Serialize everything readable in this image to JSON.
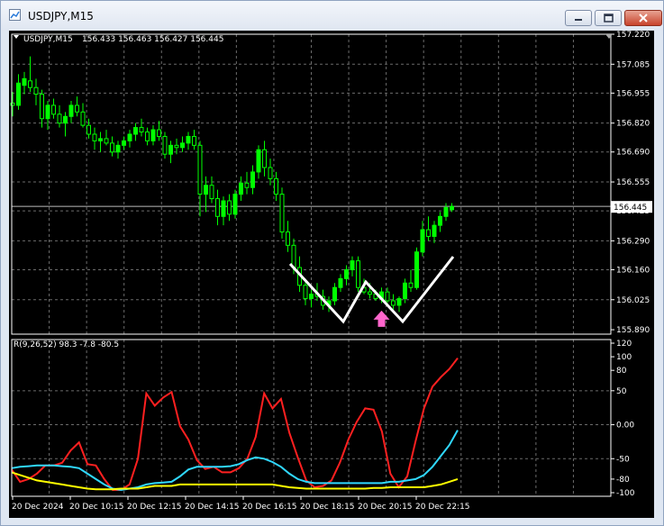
{
  "window": {
    "title": "USDJPY,M15",
    "buttons": {
      "minimize": "minimize-icon",
      "restore": "restore-icon",
      "close": "close-icon"
    }
  },
  "colors": {
    "background": "#000000",
    "grid": "#6b6b6b",
    "axis_text": "#ffffff",
    "bull_candle": "#00ff00",
    "bear_candle": "#000000",
    "price_box": "#ffffff",
    "pattern": "#ffffff",
    "arrow": "#ff66cc",
    "series_r": "#ff2020",
    "series_cyan": "#30d8ff",
    "series_yellow": "#ffff00"
  },
  "chart_data": [
    {
      "type": "candlestick",
      "title": "USDJPY,M15",
      "ohlc_header": "156.433 156.463 156.427 156.445",
      "ylim": [
        155.87,
        157.22
      ],
      "y_ticks": [
        "157.220",
        "157.085",
        "156.955",
        "156.820",
        "156.690",
        "156.555",
        "156.425",
        "156.290",
        "156.160",
        "156.025",
        "155.890"
      ],
      "current_price": "156.445",
      "grid": true,
      "candles": [
        [
          156.91,
          156.96,
          156.85,
          156.9
        ],
        [
          156.9,
          157.04,
          156.88,
          157.0
        ],
        [
          156.99,
          157.05,
          156.95,
          157.02
        ],
        [
          157.01,
          157.12,
          156.96,
          156.98
        ],
        [
          156.98,
          157.02,
          156.9,
          156.95
        ],
        [
          156.95,
          156.97,
          156.8,
          156.84
        ],
        [
          156.84,
          156.92,
          156.79,
          156.9
        ],
        [
          156.9,
          156.93,
          156.84,
          156.86
        ],
        [
          156.86,
          156.9,
          156.8,
          156.82
        ],
        [
          156.82,
          156.87,
          156.76,
          156.85
        ],
        [
          156.85,
          156.92,
          156.82,
          156.9
        ],
        [
          156.9,
          156.94,
          156.85,
          156.87
        ],
        [
          156.87,
          156.91,
          156.8,
          156.81
        ],
        [
          156.81,
          156.84,
          156.75,
          156.77
        ],
        [
          156.77,
          156.8,
          156.7,
          156.74
        ],
        [
          156.74,
          156.78,
          156.69,
          156.75
        ],
        [
          156.75,
          156.79,
          156.72,
          156.73
        ],
        [
          156.73,
          156.76,
          156.67,
          156.69
        ],
        [
          156.69,
          156.74,
          156.66,
          156.72
        ],
        [
          156.72,
          156.76,
          156.7,
          156.74
        ],
        [
          156.74,
          156.79,
          156.71,
          156.77
        ],
        [
          156.77,
          156.82,
          156.74,
          156.8
        ],
        [
          156.8,
          156.84,
          156.76,
          156.78
        ],
        [
          156.78,
          156.8,
          156.72,
          156.74
        ],
        [
          156.74,
          156.81,
          156.72,
          156.79
        ],
        [
          156.79,
          156.83,
          156.74,
          156.76
        ],
        [
          156.76,
          156.78,
          156.66,
          156.68
        ],
        [
          156.68,
          156.74,
          156.64,
          156.72
        ],
        [
          156.72,
          156.75,
          156.68,
          156.71
        ],
        [
          156.71,
          156.76,
          156.69,
          156.73
        ],
        [
          156.73,
          156.78,
          156.7,
          156.76
        ],
        [
          156.76,
          156.79,
          156.7,
          156.72
        ],
        [
          156.72,
          156.74,
          156.4,
          156.5
        ],
        [
          156.5,
          156.58,
          156.42,
          156.54
        ],
        [
          156.54,
          156.58,
          156.46,
          156.48
        ],
        [
          156.48,
          156.52,
          156.36,
          156.4
        ],
        [
          156.4,
          156.49,
          156.36,
          156.47
        ],
        [
          156.47,
          156.5,
          156.38,
          156.41
        ],
        [
          156.41,
          156.52,
          156.39,
          156.5
        ],
        [
          156.5,
          156.58,
          156.47,
          156.55
        ],
        [
          156.55,
          156.6,
          156.5,
          156.53
        ],
        [
          156.53,
          156.63,
          156.5,
          156.6
        ],
        [
          156.6,
          156.72,
          156.57,
          156.7
        ],
        [
          156.7,
          156.74,
          156.58,
          156.62
        ],
        [
          156.62,
          156.66,
          156.54,
          156.57
        ],
        [
          156.57,
          156.6,
          156.47,
          156.5
        ],
        [
          156.5,
          156.53,
          156.3,
          156.33
        ],
        [
          156.33,
          156.38,
          156.24,
          156.27
        ],
        [
          156.27,
          156.3,
          156.14,
          156.17
        ],
        [
          156.17,
          156.22,
          156.06,
          156.09
        ],
        [
          156.09,
          156.12,
          156.0,
          156.03
        ],
        [
          156.03,
          156.07,
          155.99,
          156.05
        ],
        [
          156.05,
          156.1,
          156.02,
          156.04
        ],
        [
          156.04,
          156.07,
          155.98,
          156.0
        ],
        [
          156.0,
          156.04,
          155.97,
          156.02
        ],
        [
          156.02,
          156.1,
          156.0,
          156.08
        ],
        [
          156.08,
          156.14,
          156.06,
          156.12
        ],
        [
          156.12,
          156.18,
          156.09,
          156.16
        ],
        [
          156.16,
          156.22,
          156.13,
          156.2
        ],
        [
          156.2,
          156.22,
          156.06,
          156.08
        ],
        [
          156.08,
          156.12,
          156.05,
          156.06
        ],
        [
          156.06,
          156.1,
          156.03,
          156.05
        ],
        [
          156.05,
          156.07,
          156.02,
          156.03
        ],
        [
          156.03,
          156.08,
          156.01,
          156.06
        ],
        [
          156.06,
          156.08,
          156.01,
          156.02
        ],
        [
          156.02,
          156.05,
          155.98,
          156.0
        ],
        [
          156.0,
          156.04,
          155.97,
          156.03
        ],
        [
          156.03,
          156.12,
          156.01,
          156.1
        ],
        [
          156.1,
          156.16,
          156.06,
          156.08
        ],
        [
          156.08,
          156.26,
          156.07,
          156.24
        ],
        [
          156.24,
          156.38,
          156.22,
          156.34
        ],
        [
          156.34,
          156.4,
          156.29,
          156.31
        ],
        [
          156.31,
          156.38,
          156.28,
          156.36
        ],
        [
          156.36,
          156.42,
          156.33,
          156.4
        ],
        [
          156.4,
          156.46,
          156.38,
          156.44
        ],
        [
          156.43,
          156.46,
          156.42,
          156.445
        ]
      ],
      "pattern_points": [
        [
          321,
          292
        ],
        [
          380,
          356
        ],
        [
          405,
          312
        ],
        [
          446,
          356
        ],
        [
          502,
          284
        ]
      ],
      "arrow": {
        "candle_index": 63,
        "price": 156.0
      }
    },
    {
      "type": "line",
      "title": "R(9,26,52) 98.3 -7.8 -80.5",
      "ylim": [
        -100,
        120
      ],
      "y_ticks": [
        "120",
        "100",
        "80",
        "50",
        "0.00",
        "-50",
        "-80",
        "-100"
      ],
      "series": [
        {
          "name": "R(9,26,52) 98.3",
          "values": [
            -66,
            -84,
            -80,
            -72,
            -60,
            -60,
            -56,
            -38,
            -26,
            -58,
            -60,
            -80,
            -96,
            -96,
            -88,
            -50,
            46,
            28,
            40,
            48,
            -2,
            -22,
            -52,
            -65,
            -62,
            -70,
            -70,
            -64,
            -50,
            -18,
            46,
            24,
            38,
            -12,
            -48,
            -82,
            -92,
            -90,
            -82,
            -56,
            -22,
            4,
            24,
            22,
            -10,
            -72,
            -92,
            -76,
            -24,
            24,
            56,
            70,
            82,
            98
          ]
        },
        {
          "name": "-7.8",
          "values": [
            -64,
            -62,
            -61,
            -60,
            -60,
            -60,
            -61,
            -62,
            -64,
            -72,
            -80,
            -88,
            -94,
            -96,
            -94,
            -92,
            -88,
            -86,
            -85,
            -84,
            -76,
            -66,
            -62,
            -62,
            -62,
            -62,
            -61,
            -58,
            -52,
            -48,
            -50,
            -55,
            -62,
            -72,
            -80,
            -84,
            -86,
            -86,
            -86,
            -86,
            -86,
            -86,
            -86,
            -86,
            -86,
            -84,
            -84,
            -82,
            -80,
            -74,
            -62,
            -46,
            -30,
            -8
          ]
        },
        {
          "name": "-80.5",
          "values": [
            -70,
            -74,
            -78,
            -82,
            -84,
            -86,
            -88,
            -90,
            -92,
            -94,
            -95,
            -95,
            -95,
            -94,
            -94,
            -94,
            -92,
            -90,
            -90,
            -90,
            -88,
            -88,
            -88,
            -88,
            -88,
            -88,
            -88,
            -88,
            -88,
            -88,
            -88,
            -88,
            -90,
            -92,
            -93,
            -94,
            -94,
            -94,
            -94,
            -94,
            -94,
            -94,
            -94,
            -93,
            -93,
            -92,
            -92,
            -92,
            -92,
            -92,
            -90,
            -88,
            -84,
            -80
          ]
        }
      ]
    }
  ],
  "x_axis": {
    "labels": [
      "20 Dec 2024",
      "20 Dec 10:15",
      "20 Dec 12:15",
      "20 Dec 14:15",
      "20 Dec 16:15",
      "20 Dec 18:15",
      "20 Dec 20:15",
      "20 Dec 22:15"
    ]
  }
}
